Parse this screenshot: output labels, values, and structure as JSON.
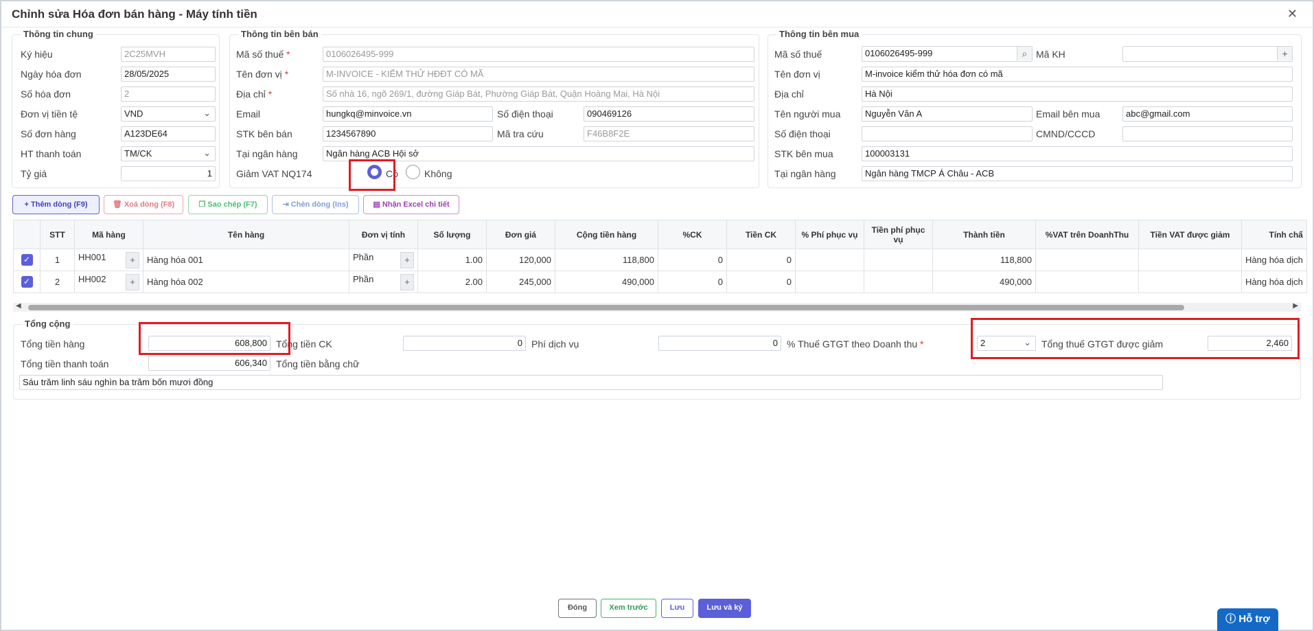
{
  "window": {
    "title": "Chỉnh sửa Hóa đơn bán hàng - Máy tính tiền",
    "close_glyph": "✕"
  },
  "general": {
    "legend": "Thông tin chung",
    "fields": [
      {
        "label": "Ký hiệu",
        "value": "2C25MVH"
      },
      {
        "label": "Ngày hóa đơn",
        "value": "28/05/2025"
      },
      {
        "label": "Số hóa đơn",
        "value": "2"
      },
      {
        "label": "Đơn vị tiền tệ",
        "value": "VND"
      },
      {
        "label": "Số đơn hàng",
        "value": "A123DE64"
      },
      {
        "label": "HT thanh toán",
        "value": "TM/CK"
      },
      {
        "label": "Tỷ giá",
        "value": "1"
      }
    ]
  },
  "seller": {
    "legend": "Thông tin bên bán",
    "tax_code": {
      "label": "Mã số thuế",
      "value": "0106026495-999"
    },
    "unit_name": {
      "label": "Tên đơn vị",
      "value": "M-INVOICE - KIỂM THỬ HĐĐT CÓ MÃ"
    },
    "address": {
      "label": "Địa chỉ",
      "value": "Số nhà 16, ngõ 269/1, đường Giáp Bát, Phường Giáp Bát, Quận Hoàng Mai, Hà Nội"
    },
    "email": {
      "label": "Email",
      "value": "hungkq@minvoice.vn"
    },
    "phone": {
      "label": "Số điện thoại",
      "value": "090469126"
    },
    "bank_account": {
      "label": "STK bên bán",
      "value": "1234567890"
    },
    "lookup_code": {
      "label": "Mã tra cứu",
      "value": "F46B8F2E"
    },
    "bank": {
      "label": "Tại ngân hàng",
      "value": "Ngân hàng ACB Hội sở"
    },
    "vat_reduction": {
      "label": "Giảm VAT NQ174",
      "yes": "Có",
      "no": "Không",
      "selected": "yes"
    }
  },
  "buyer": {
    "legend": "Thông tin bên mua",
    "tax_code": {
      "label": "Mã số thuế",
      "value": "0106026495-999"
    },
    "customer_code": {
      "label": "Mã KH",
      "value": ""
    },
    "unit_name": {
      "label": "Tên đơn vị",
      "value": "M-invoice kiểm thử hóa đơn có mã"
    },
    "address": {
      "label": "Địa chỉ",
      "value": "Hà Nội"
    },
    "buyer_name": {
      "label": "Tên người mua",
      "value": "Nguyễn Văn A"
    },
    "buyer_email": {
      "label": "Email bên mua",
      "value": "abc@gmail.com"
    },
    "phone": {
      "label": "Số điện thoại",
      "value": ""
    },
    "id_card": {
      "label": "CMND/CCCD",
      "value": ""
    },
    "bank_account": {
      "label": "STK bên mua",
      "value": "100003131"
    },
    "bank": {
      "label": "Tại ngân hàng",
      "value": "Ngân hàng TMCP Á Châu - ACB"
    }
  },
  "toolbar": {
    "add_row": "Thêm dòng (F9)",
    "delete_row": "Xoá dòng (F8)",
    "copy": "Sao chép (F7)",
    "insert_row": "Chèn dòng (Ins)",
    "import_excel": "Nhận Excel chi tiết"
  },
  "table": {
    "headers": [
      "",
      "STT",
      "Mã hàng",
      "Tên hàng",
      "Đơn vị tính",
      "Số lượng",
      "Đơn giá",
      "Cộng tiền hàng",
      "%CK",
      "Tiền CK",
      "% Phí phục vụ",
      "Tiền phí phục vụ",
      "Thành tiền",
      "%VAT trên DoanhThu",
      "Tiền VAT được giảm",
      "Tính chấ"
    ],
    "rows": [
      {
        "stt": "1",
        "code": "HH001",
        "name": "Hàng hóa 001",
        "unit": "Phần",
        "qty": "1.00",
        "price": "120,000",
        "subtotal": "118,800",
        "disc_pct": "0",
        "disc_amt": "0",
        "svc_pct": "",
        "svc_amt": "",
        "total": "118,800",
        "vat_pct": "",
        "vat_reduced": "",
        "nature": "Hàng hóa dịch"
      },
      {
        "stt": "2",
        "code": "HH002",
        "name": "Hàng hóa 002",
        "unit": "Phần",
        "qty": "2.00",
        "price": "245,000",
        "subtotal": "490,000",
        "disc_pct": "0",
        "disc_amt": "0",
        "svc_pct": "",
        "svc_amt": "",
        "total": "490,000",
        "vat_pct": "",
        "vat_reduced": "",
        "nature": "Hàng hóa dịch"
      }
    ]
  },
  "totals": {
    "legend": "Tổng cộng",
    "goods_total": {
      "label": "Tổng tiền hàng",
      "value": "608,800"
    },
    "discount_total": {
      "label": "Tổng tiền CK",
      "value": "0"
    },
    "service_fee": {
      "label": "Phí dịch vụ",
      "value": "0"
    },
    "vat_rate": {
      "label": "% Thuế GTGT theo Doanh thu",
      "value": "2"
    },
    "vat_reduced_total": {
      "label": "Tổng thuế GTGT được giảm",
      "value": "2,460"
    },
    "payment_total": {
      "label": "Tổng tiền thanh toán",
      "value": "606,340"
    },
    "in_words": {
      "label": "Tổng tiền bằng chữ",
      "value": "Sáu trăm linh sáu nghìn ba trăm bốn mươi đồng"
    }
  },
  "footer": {
    "close": "Đóng",
    "preview": "Xem trước",
    "save": "Lưu",
    "save_sign": "Lưu và ký",
    "help": "Hỗ trợ"
  },
  "colors": {
    "primary": "#5b5fd9",
    "highlight": "#e11b22",
    "help": "#1469c7"
  }
}
